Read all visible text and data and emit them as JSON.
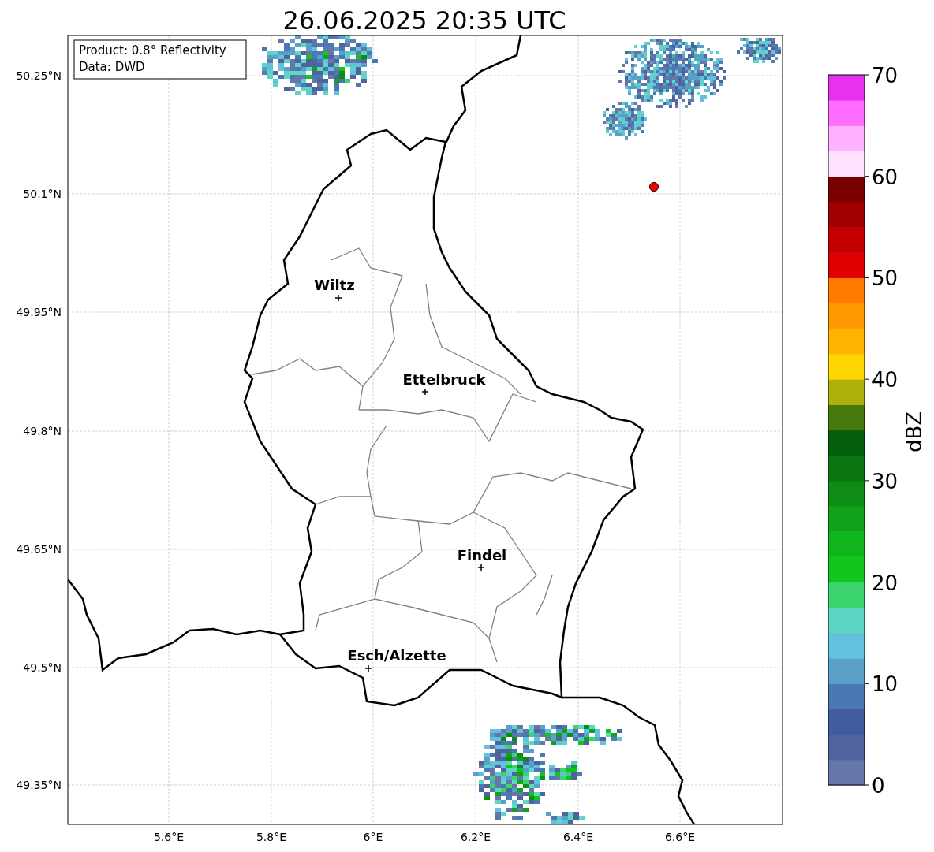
{
  "title": "26.06.2025 20:35 UTC",
  "info_box": {
    "lines": [
      "Product: 0.8° Reflectivity",
      "Data: DWD"
    ]
  },
  "map": {
    "lat_ticks": [
      "50.25°N",
      "50.1°N",
      "49.95°N",
      "49.8°N",
      "49.65°N",
      "49.5°N",
      "49.35°N"
    ],
    "lon_ticks": [
      "5.6°E",
      "5.8°E",
      "6°E",
      "6.2°E",
      "6.4°E",
      "6.6°E"
    ],
    "towns": [
      {
        "name": "Wiltz"
      },
      {
        "name": "Ettelbruck"
      },
      {
        "name": "Findel"
      },
      {
        "name": "Esch/Alzette"
      }
    ]
  },
  "colorbar": {
    "label": "dBZ",
    "ticks": [
      "70",
      "60",
      "50",
      "40",
      "30",
      "20",
      "10",
      "0"
    ],
    "bins": [
      {
        "color": "#6577a8"
      },
      {
        "color": "#4f649e"
      },
      {
        "color": "#415ca0"
      },
      {
        "color": "#4a78b3"
      },
      {
        "color": "#58a0c8"
      },
      {
        "color": "#62c1dc"
      },
      {
        "color": "#5dd6c4"
      },
      {
        "color": "#3bd46e"
      },
      {
        "color": "#10c61c"
      },
      {
        "color": "#10b41c"
      },
      {
        "color": "#10a21a"
      },
      {
        "color": "#0e8c16"
      },
      {
        "color": "#0b7512"
      },
      {
        "color": "#065f0e"
      },
      {
        "color": "#467a0c"
      },
      {
        "color": "#b0b00a"
      },
      {
        "color": "#ffd700"
      },
      {
        "color": "#ffb400"
      },
      {
        "color": "#ff9a00"
      },
      {
        "color": "#ff7b00"
      },
      {
        "color": "#e00000"
      },
      {
        "color": "#c40000"
      },
      {
        "color": "#a00000"
      },
      {
        "color": "#7a0000"
      },
      {
        "color": "#ffe0ff"
      },
      {
        "color": "#ffb0ff"
      },
      {
        "color": "#ff6aff"
      },
      {
        "color": "#e830f0"
      }
    ]
  }
}
